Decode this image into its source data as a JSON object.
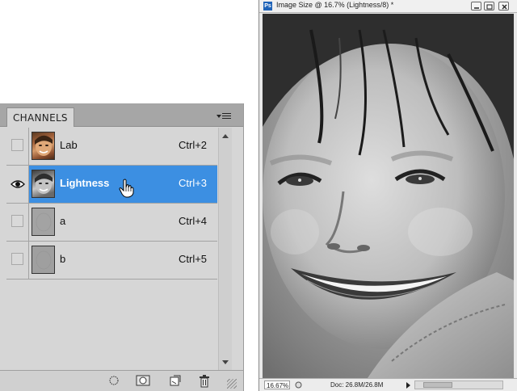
{
  "panel": {
    "tab_label": "CHANNELS",
    "channels": [
      {
        "name": "Lab",
        "shortcut": "Ctrl+2",
        "visible": false,
        "selected": false,
        "thumb": "color"
      },
      {
        "name": "Lightness",
        "shortcut": "Ctrl+3",
        "visible": true,
        "selected": true,
        "thumb": "gray"
      },
      {
        "name": "a",
        "shortcut": "Ctrl+4",
        "visible": false,
        "selected": false,
        "thumb": "flat"
      },
      {
        "name": "b",
        "shortcut": "Ctrl+5",
        "visible": false,
        "selected": false,
        "thumb": "flat"
      }
    ],
    "bottom_icons": [
      "load-selection-icon",
      "save-selection-icon",
      "new-channel-icon",
      "trash-icon"
    ],
    "selection_color": "#3c8fe2"
  },
  "document": {
    "title": "Image Size @ 16.7% (Lightness/8) *",
    "app_icon": "Ps",
    "zoom": "16.67%",
    "doc_size": "Doc: 26.8M/26.8M",
    "window_buttons": [
      "minimize-icon",
      "restore-icon",
      "close-icon"
    ]
  }
}
